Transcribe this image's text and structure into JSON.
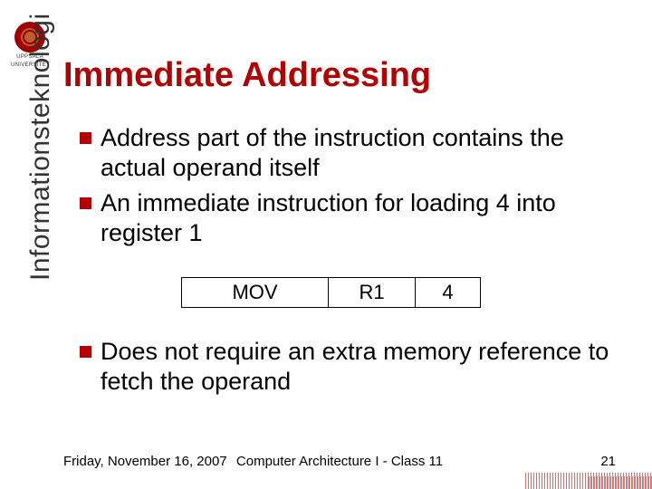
{
  "logo": {
    "university": "UPPSALA",
    "suffix": "UNIVERSITET"
  },
  "title": "Immediate Addressing",
  "sidebar_label": "Informationsteknologi",
  "bullets_top": [
    "Address part of the instruction contains the actual operand itself",
    "An immediate instruction for loading 4 into register 1"
  ],
  "instruction": {
    "opcode": "MOV",
    "reg": "R1",
    "imm": "4"
  },
  "bullets_bottom": [
    "Does not require an extra memory reference to fetch the operand"
  ],
  "footer": {
    "date": "Friday, November 16, 2007",
    "course": "Computer Architecture I - Class 11",
    "page": "21"
  }
}
